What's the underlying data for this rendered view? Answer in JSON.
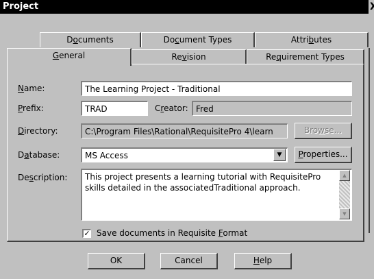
{
  "window": {
    "title": "Project",
    "close_glyph": "X"
  },
  "tabs_back": [
    {
      "id": "documents",
      "pre": "D",
      "acc": "o",
      "post": "cuments"
    },
    {
      "id": "document-types",
      "pre": "Do",
      "acc": "c",
      "post": "ument Types"
    },
    {
      "id": "attributes",
      "pre": "Attri",
      "acc": "b",
      "post": "utes"
    }
  ],
  "tabs_front": [
    {
      "id": "general",
      "pre": "",
      "acc": "G",
      "post": "eneral",
      "active": true
    },
    {
      "id": "revision",
      "pre": "Re",
      "acc": "v",
      "post": "ision"
    },
    {
      "id": "requirement-types",
      "pre": "Re",
      "acc": "q",
      "post": "uirement Types"
    }
  ],
  "form": {
    "name": {
      "pre": "",
      "acc": "N",
      "post": "ame:",
      "value": "The Learning Project - Traditional"
    },
    "prefix": {
      "pre": "",
      "acc": "P",
      "post": "refix:",
      "value": "TRAD"
    },
    "creator": {
      "pre": "C",
      "acc": "r",
      "post": "eator:",
      "value": "Fred"
    },
    "directory": {
      "pre": "",
      "acc": "D",
      "post": "irectory:",
      "value": "C:\\Program Files\\Rational\\RequisitePro 4\\learn"
    },
    "browse": {
      "pre": "Bro",
      "acc": "w",
      "post": "se..."
    },
    "database": {
      "pre": "D",
      "acc": "a",
      "post": "tabase:",
      "value": "MS Access",
      "arrow": "▼"
    },
    "properties": {
      "pre": "",
      "acc": "P",
      "post": "roperties..."
    },
    "description": {
      "pre": "De",
      "acc": "s",
      "post": "cription:",
      "value": "This project presents a learning tutorial with  RequisitePro\nskills detailed in the associatedTraditional approach.",
      "up": "▲",
      "down": "▼"
    },
    "save_format": {
      "checked": "✓",
      "pre": "Save documents in Requisite ",
      "acc": "F",
      "post": "ormat"
    }
  },
  "buttons": {
    "ok": {
      "pre": "",
      "acc": "",
      "post": "OK"
    },
    "cancel": {
      "pre": "",
      "acc": "",
      "post": "Cancel"
    },
    "help": {
      "pre": "",
      "acc": "H",
      "post": "elp"
    }
  }
}
